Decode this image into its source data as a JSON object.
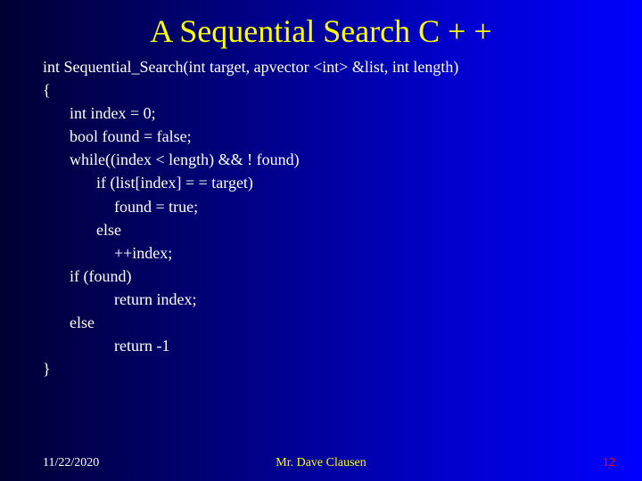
{
  "title": "A Sequential Search C + +",
  "code": {
    "l0": "int Sequential_Search(int target, apvector <int> &list, int length)",
    "l1": "{",
    "l2": "int index = 0;",
    "l3": "bool found = false;",
    "l4": "while((index < length) && ! found)",
    "l5": "if (list[index] = = target)",
    "l6": "found = true;",
    "l7": "else",
    "l8": "++index;",
    "l9": "if (found)",
    "l10": "return index;",
    "l11": "else",
    "l12": "return -1",
    "l13": "}"
  },
  "footer": {
    "date": "11/22/2020",
    "author": "Mr. Dave Clausen",
    "page": "12"
  }
}
